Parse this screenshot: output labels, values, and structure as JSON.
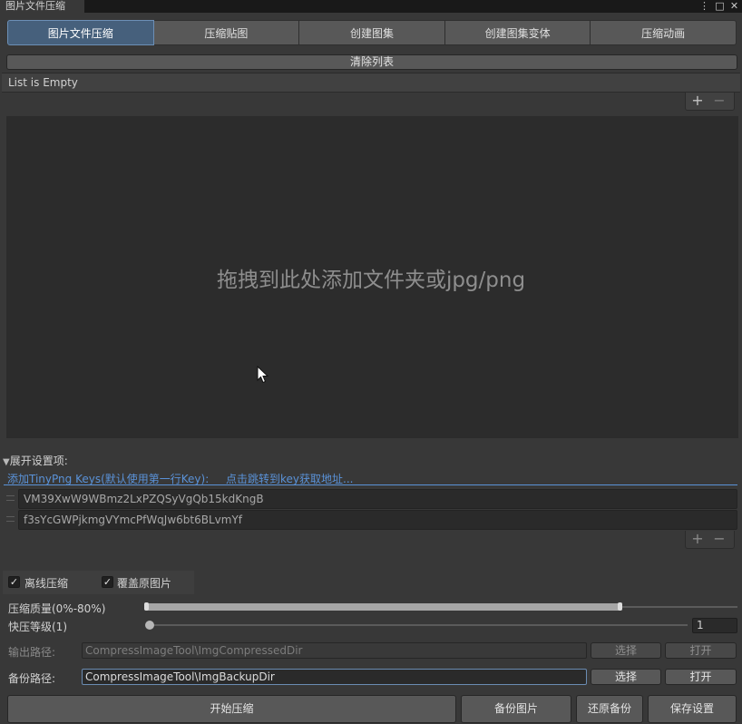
{
  "window": {
    "title": "图片文件压缩",
    "menu_icon": "⋮",
    "max_icon": "□",
    "close_icon": "✕"
  },
  "tabs": [
    {
      "label": "图片文件压缩",
      "active": true
    },
    {
      "label": "压缩贴图",
      "active": false
    },
    {
      "label": "创建图集",
      "active": false
    },
    {
      "label": "创建图集变体",
      "active": false
    },
    {
      "label": "压缩动画",
      "active": false
    }
  ],
  "file_list": {
    "clear_label": "清除列表",
    "empty_text": "List is Empty",
    "add_icon": "+",
    "remove_icon": "−",
    "drop_hint": "拖拽到此处添加文件夹或jpg/png"
  },
  "settings": {
    "foldout_label": "展开设置项:",
    "foldout_arrow": "▼",
    "tinypng_label": "添加TinyPng Keys(默认使用第一行Key):",
    "key_link": "点击跳转到key获取地址...",
    "keys": [
      "VM39XwW9WBmz2LxPZQSyVgQb15kdKngB",
      "f3sYcGWPjkmgVYmcPfWqJw6bt6BLvmYf"
    ],
    "offline_label": "离线压缩",
    "offline_checked": true,
    "overwrite_label": "覆盖原图片",
    "overwrite_checked": true,
    "check_mark": "✓",
    "quality_label": "压缩质量(0%-80%)",
    "quality_value": 0.8,
    "speed_label": "快压等级(1)",
    "speed_value": "1"
  },
  "paths": {
    "output_label": "输出路径:",
    "output_value": "CompressImageTool\\ImgCompressedDir",
    "backup_label": "备份路径:",
    "backup_value": "CompressImageTool\\ImgBackupDir",
    "select_label": "选择",
    "open_label": "打开"
  },
  "actions": {
    "start_label": "开始压缩",
    "backup_label": "备份图片",
    "restore_label": "还原备份",
    "save_label": "保存设置"
  },
  "colors": {
    "accent": "#46607c",
    "link": "#5a92d8",
    "background": "#383838"
  }
}
